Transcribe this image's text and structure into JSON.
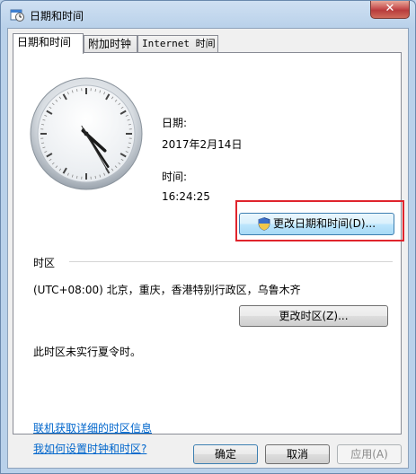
{
  "window": {
    "title": "日期和时间",
    "close_glyph": "✕"
  },
  "tabs": [
    {
      "label": "日期和时间",
      "active": true
    },
    {
      "label": "附加时钟",
      "active": false
    },
    {
      "label": "Internet 时间",
      "active": false
    }
  ],
  "clock": {
    "hour": 16,
    "minute": 24,
    "second": 25
  },
  "date": {
    "label": "日期:",
    "value": "2017年2月14日"
  },
  "time": {
    "label": "时间:",
    "value": "16:24:25"
  },
  "change_datetime_button": "更改日期和时间(D)...",
  "timezone": {
    "section_label": "时区",
    "value": "(UTC+08:00) 北京，重庆，香港特别行政区，乌鲁木齐",
    "change_button": "更改时区(Z)...",
    "dst_note": "此时区未实行夏令时。"
  },
  "links": {
    "online_info": "联机获取详细的时区信息",
    "how_to": "我如何设置时钟和时区?"
  },
  "footer": {
    "ok": "确定",
    "cancel": "取消",
    "apply": "应用(A)"
  },
  "colors": {
    "highlight": "#e0242c",
    "link": "#0066cc"
  }
}
